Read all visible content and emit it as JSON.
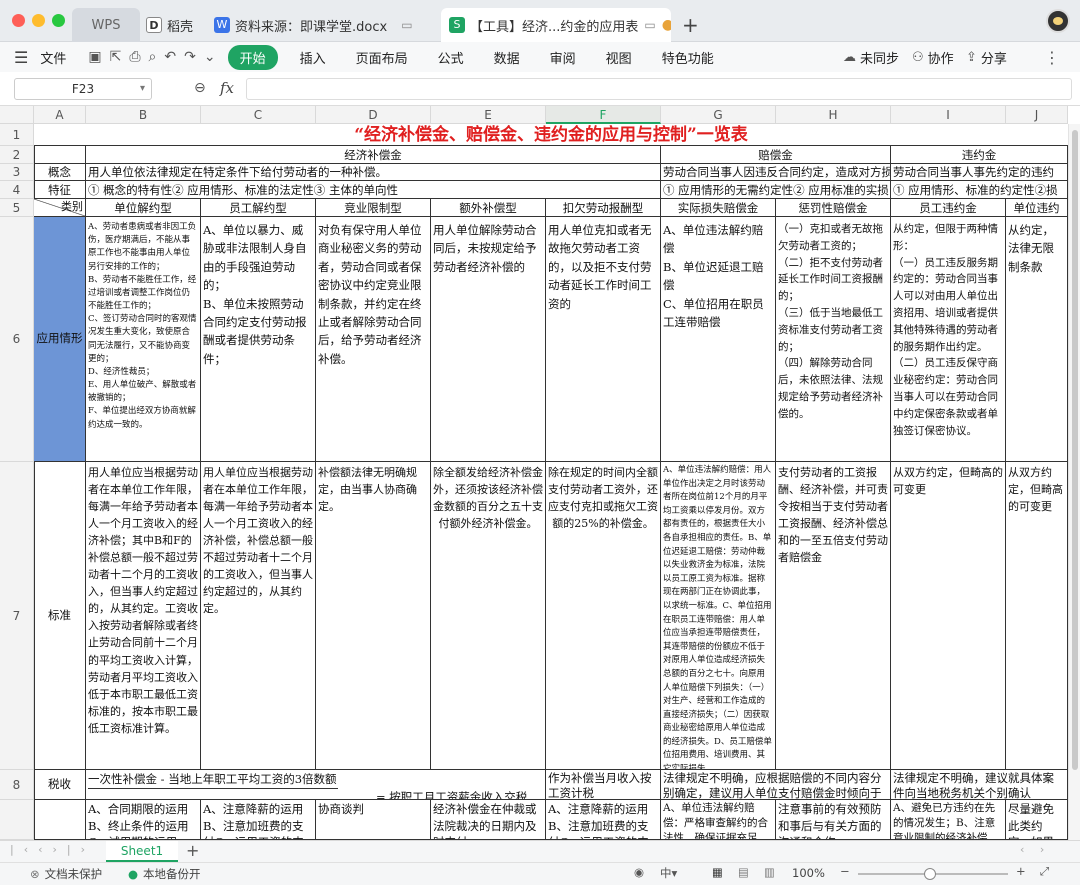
{
  "tabs": [
    {
      "label": "WPS"
    },
    {
      "label": "稻壳"
    },
    {
      "label": "资料来源：即课学堂.docx"
    },
    {
      "label": "【工具】经济...约金的应用表"
    }
  ],
  "menu": {
    "file": "文件",
    "items": [
      "开始",
      "插入",
      "页面布局",
      "公式",
      "数据",
      "审阅",
      "视图",
      "特色功能"
    ],
    "unsynced": "未同步",
    "collab": "协作",
    "share": "分享"
  },
  "formula": {
    "cell_ref": "F23",
    "fx": "fx",
    "value": ""
  },
  "columns": [
    "A",
    "B",
    "C",
    "D",
    "E",
    "F",
    "G",
    "H",
    "I",
    "J"
  ],
  "rows": [
    "1",
    "2",
    "3",
    "4",
    "5",
    "6",
    "7",
    "8"
  ],
  "sheet": {
    "title": "“经济补偿金、赔偿金、违约金的应用与控制”一览表",
    "group_econ": "经济补偿金",
    "group_comp": "赔偿金",
    "group_pen": "违约金",
    "concept_label": "概念",
    "concept_econ": "用人单位依法律规定在特定条件下给付劳动者的一种补偿。",
    "concept_comp": "劳动合同当事人因违反合同约定，造成对方损",
    "concept_pen": "劳动合同当事人事先约定的违约",
    "feature_label": "特征",
    "feature_econ": "① 概念的特有性② 应用情形、标准的法定性③ 主体的单向性",
    "feature_comp": "① 应用情形的无需约定性② 应用标准的实损",
    "feature_pen": "① 应用情形、标准的约定性②损",
    "category_label": "类别",
    "cat": [
      "单位解约型",
      "员工解约型",
      "竞业限制型",
      "额外补偿型",
      "扣欠劳动报酬型",
      "实际损失赔偿金",
      "惩罚性赔偿金",
      "员工违约金",
      "单位违约金"
    ],
    "apply_label": "应用情形",
    "apply": [
      "A、劳动者患病或者非因工负伤，医疗期满后，不能从事原工作也不能事由用人单位另行安排的工作的；\nB、劳动者不能胜任工作，经过培训或者调整工作岗位仍不能胜任工作的；\nC、签订劳动合同时的客观情况发生重大变化，致使原合同无法履行，又不能协商变更的；\nD、经济性裁员；\nE、用人单位破产、解散或者被撤销的；\nF、单位提出经双方协商就解约达成一致的。",
      "A、单位以暴力、威胁或非法限制人身自由的手段强迫劳动的；\nB、单位未按照劳动合同约定支付劳动报酬或者提供劳动条件；",
      "对负有保守用人单位商业秘密义务的劳动者，劳动合同或者保密协议中约定竞业限制条款，并约定在终止或者解除劳动合同后，给予劳动者经济补偿。",
      "用人单位解除劳动合同后，未按规定给予劳动者经济补偿的",
      "用人单位克扣或者无故拖欠劳动者工资的，以及拒不支付劳动者延长工作时间工资的",
      "A、单位违法解约赔偿\nB、单位迟延退工赔偿\nC、单位招用在职员工连带赔偿",
      "（一）克扣或者无故拖欠劳动者工资的；\n（二）拒不支付劳动者延长工作时间工资报酬的；\n（三）低于当地最低工资标准支付劳动者工资的；\n（四）解除劳动合同后，未依照法律、法规规定给予劳动者经济补偿的。",
      "从约定，但限于两种情形：\n（一）员工违反服务期约定的：劳动合同当事人可以对由用人单位出资招用、培训或者提供其他特殊待遇的劳动者的服务期作出约定。\n（二）员工违反保守商业秘密约定：劳动合同当事人可以在劳动合同中约定保密条款或者单独签订保密协议。",
      "从约定，法律无限制条款"
    ],
    "std_label": "标准",
    "std": [
      "用人单位应当根据劳动者在本单位工作年限，每满一年给予劳动者本人一个月工资收入的经济补偿；其中B和F的补偿总额一般不超过劳动者十二个月的工资收入，但当事人约定超过的，从其约定。工资收入按劳动者解除或者终止劳动合同前十二个月的平均工资收入计算，劳动者月平均工资收入低于本市职工最低工资标准的，按本市职工最低工资标准计算。",
      "用人单位应当根据劳动者在本单位工作年限，每满一年给予劳动者本人一个月工资收入的经济补偿，补偿总额一般不超过劳动者十二个月的工资收入，但当事人约定超过的，从其约定。",
      "补偿额法律无明确规定，由当事人协商确定。",
      "除全额发给经济补偿金外，还须按该经济补偿金数额的百分之五十支付额外经济补偿金。",
      "除在规定的时间内全额支付劳动者工资外，还应支付克扣或拖欠工资额的25%的补偿金。",
      "A、单位违法解约赔偿：用人单位作出决定之月时该劳动者所在岗位前12个月的月平均工资乘以停发月份。双方都有责任的，根据责任大小各自承担相应的责任。B、单位迟延退工赔偿：劳动仲裁以失业救济金为标准，法院以员工原工资为标准。据称现在两部门正在协调此事，以求统一标准。C、单位招用在职员工连带赔偿：用人单位应当承担连带赔偿责任，其连带赔偿的份额应不低于对原用人单位造成经济损失总额的百分之七十。向原用人单位赔偿下列损失：（一）对生产、经营和工作造成的直接经济损失；（二）因获取商业秘密给原用人单位造成的经济损失。D、员工赔偿单位招用费用、培训费用、其它实际损失",
      "支付劳动者的工资报酬、经济补偿，并可责令按相当于支付劳动者工资报酬、经济补偿总和的一至五倍支付劳动者赔偿金",
      "从双方约定，但畸高的可变更",
      "从双方约定，但畸高的可变更"
    ],
    "tax_label": "税收",
    "tax_econ_1": "一次性补偿金 - 当地上年职工平均工资的3倍数额",
    "tax_econ_2": "= 按职工月工资薪金收入交税",
    "tax_owed": "作为补偿当月收入按工资计税",
    "tax_comp": "法律规定不明确，应根据赔偿的不同内容分别确定，建议用人单位支付赔偿金时倾向于代扣",
    "tax_pen": "法律规定不明确，建议就具体案件向当地税务机关个别确认",
    "control": [
      "A、合同期限的运用B、终止条件的运用C、试用期的运用D、利用",
      "A、注意降薪的运用B、注意加班费的支付C、运用工资的支付形式",
      "协商谈判",
      "经济补偿金在仲裁或法院裁决的日期内及时支付",
      "A、注意降薪的运用B、注意加班费的支付C、运用工资的支付形式",
      "A、单位违法解约赔偿：严格审查解约的合法性，确保证据充足",
      "注意事前的有效预防和事后与有关方面的沟通和合作",
      "A、避免已方违约在先的情况发生；B、注意竞业限制的经济补偿",
      "尽量避免此类约定，如果约定"
    ]
  },
  "sheet_tab": "Sheet1",
  "status": {
    "protect": "文档未保护",
    "backup": "本地备份开",
    "zoom": "100%"
  }
}
